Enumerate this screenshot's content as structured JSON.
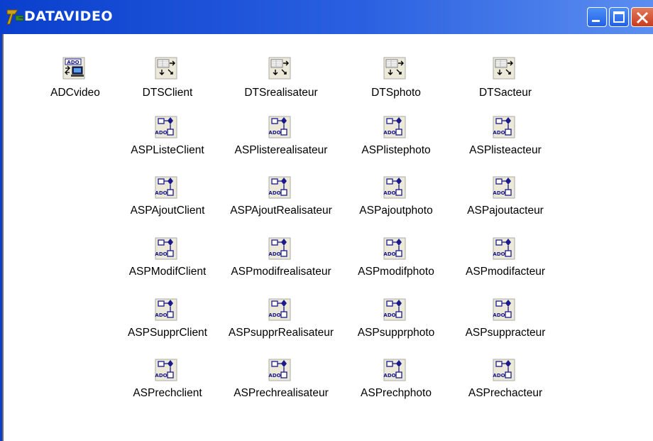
{
  "window": {
    "title": "DATAVIDEO",
    "app_icon": "delphi-icon",
    "controls": [
      "minimize-icon",
      "maximize-icon",
      "close-icon"
    ],
    "colors": {
      "titlebar": "#0a3fcd",
      "close": "#c93b1c"
    }
  },
  "connection": {
    "label": "ADCvideo",
    "icon": "ado-connection-icon"
  },
  "datasets": [
    {
      "label": "DTSClient",
      "icon": "dataset-provider-icon"
    },
    {
      "label": "DTSrealisateur",
      "icon": "dataset-provider-icon"
    },
    {
      "label": "DTSphoto",
      "icon": "dataset-provider-icon"
    },
    {
      "label": "DTSacteur",
      "icon": "dataset-provider-icon"
    }
  ],
  "procedures": [
    [
      "ASPListeClient",
      "ASPlisterealisateur",
      "ASPlistephoto",
      "ASPlisteacteur"
    ],
    [
      "ASPAjoutClient",
      "ASPAjoutRealisateur",
      "ASPajoutphoto",
      "ASPajoutacteur"
    ],
    [
      "ASPModifClient",
      "ASPmodifrealisateur",
      "ASPmodifphoto",
      "ASPmodifacteur"
    ],
    [
      "ASPSupprClient",
      "ASPsupprRealisateur",
      "ASPsupprphoto",
      "ASPsuppracteur"
    ],
    [
      "ASPrechclient",
      "ASPrechrealisateur",
      "ASPrechphoto",
      "ASPrechacteur"
    ]
  ],
  "procedure_icon": "ado-stored-proc-icon"
}
